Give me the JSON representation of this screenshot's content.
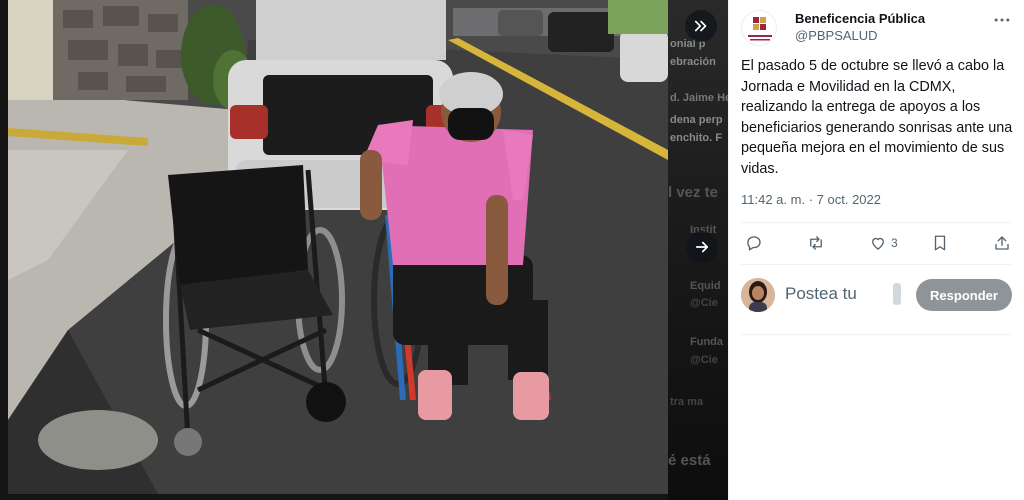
{
  "viewer": {
    "backdrop_texts": [
      "onial p",
      "ebración",
      "d. Jaime He",
      "dena perp",
      "enchito. F",
      "l vez te",
      "Instit",
      "Equid",
      "@Cie",
      "Funda",
      "@Cie",
      "tra ma",
      "é está"
    ]
  },
  "tweet": {
    "author_name": "Beneficencia Pública",
    "author_handle": "@PBPSALUD",
    "logo_text": "BENEFICENCIA PÚBLICA",
    "text": "El pasado 5 de octubre se llevó a cabo la Jornada e Movilidad en la CDMX, realizando la entrega de apoyos a los beneficiarios generando sonrisas ante una pequeña mejora en el movimiento de sus vidas.",
    "time": "11:42 a. m.",
    "separator": "·",
    "date": "7 oct. 2022",
    "likes": "3"
  },
  "reply": {
    "placeholder": "Postea tu",
    "button_label": "Responder"
  },
  "icons": {
    "expand": "chevrons-right-icon",
    "next": "arrow-right-icon",
    "more": "ellipsis-icon",
    "reply": "comment-icon",
    "retweet": "retweet-icon",
    "like": "heart-icon",
    "bookmark": "bookmark-icon",
    "share": "share-icon"
  },
  "colors": {
    "text": "#0f1419",
    "muted": "#536471",
    "reply_button": "#8f9498"
  }
}
